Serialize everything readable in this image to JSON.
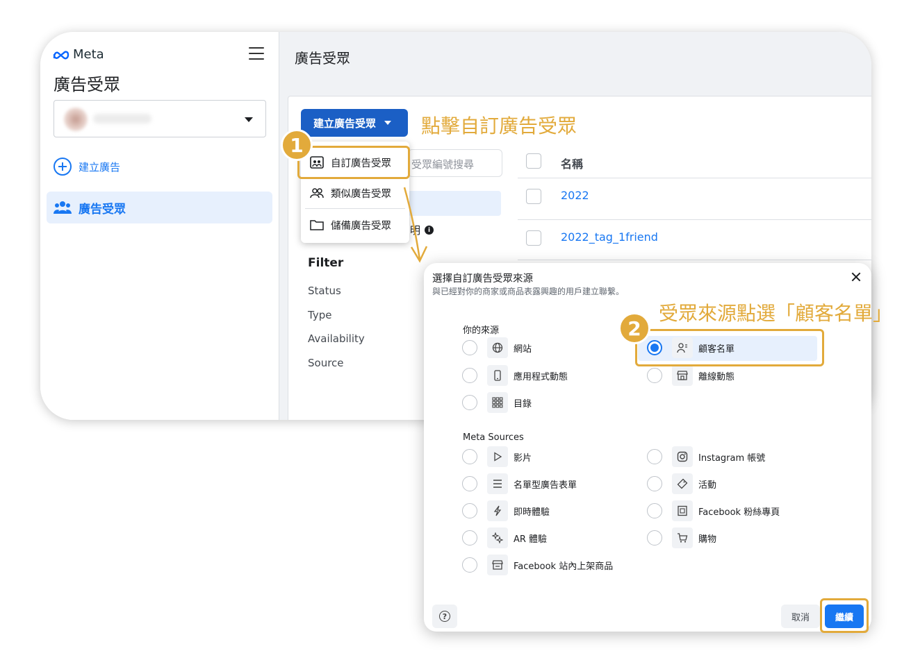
{
  "sidebar": {
    "logo_text": "Meta",
    "title": "廣告受眾",
    "create_ad": "建立廣告",
    "active_item": "廣告受眾"
  },
  "main": {
    "title": "廣告受眾",
    "create_button": "建立廣告受眾",
    "search_placeholder": "受眾編號搜尋",
    "help_fragment": "明",
    "filter": {
      "title": "Filter",
      "items": [
        "Status",
        "Type",
        "Availability",
        "Source"
      ]
    },
    "table": {
      "header": "名稱",
      "rows": [
        "2022",
        "2022_tag_1friend"
      ]
    }
  },
  "dropdown": {
    "items": [
      "自訂廣告受眾",
      "類似廣告受眾",
      "儲備廣告受眾"
    ]
  },
  "modal": {
    "title": "選擇自訂廣告受眾來源",
    "subtitle": "與已經對你的商家或商品表露興趣的用戶建立聯繫。",
    "your_sources_label": "你的來源",
    "your_sources": [
      {
        "label": "網站",
        "icon": "globe-icon",
        "selected": false
      },
      {
        "label": "顧客名單",
        "icon": "person-list-icon",
        "selected": true
      },
      {
        "label": "應用程式動態",
        "icon": "mobile-icon",
        "selected": false
      },
      {
        "label": "離線動態",
        "icon": "store-icon",
        "selected": false
      },
      {
        "label": "目錄",
        "icon": "grid-icon",
        "selected": false
      }
    ],
    "meta_sources_label": "Meta Sources",
    "meta_sources": [
      {
        "label": "影片",
        "icon": "play-icon"
      },
      {
        "label": "Instagram 帳號",
        "icon": "instagram-icon"
      },
      {
        "label": "名單型廣告表單",
        "icon": "list-icon"
      },
      {
        "label": "活動",
        "icon": "tag-icon"
      },
      {
        "label": "即時體驗",
        "icon": "bolt-icon"
      },
      {
        "label": "Facebook 粉絲專頁",
        "icon": "page-icon"
      },
      {
        "label": "AR 體驗",
        "icon": "sparkle-icon"
      },
      {
        "label": "購物",
        "icon": "cart-icon"
      },
      {
        "label": "Facebook 站內上架商品",
        "icon": "shop-icon"
      }
    ],
    "help": "?",
    "cancel": "取消",
    "next": "繼續"
  },
  "annotations": {
    "step1": "1",
    "step1_note": "點擊自訂廣告受眾",
    "step2": "2",
    "step2_note": "受眾來源點選「顧客名單」",
    "color": "#e2aa3b"
  },
  "colors": {
    "accent": "#1877f2",
    "primary_button": "#1b5fc5",
    "highlight": "#e2aa3b"
  }
}
